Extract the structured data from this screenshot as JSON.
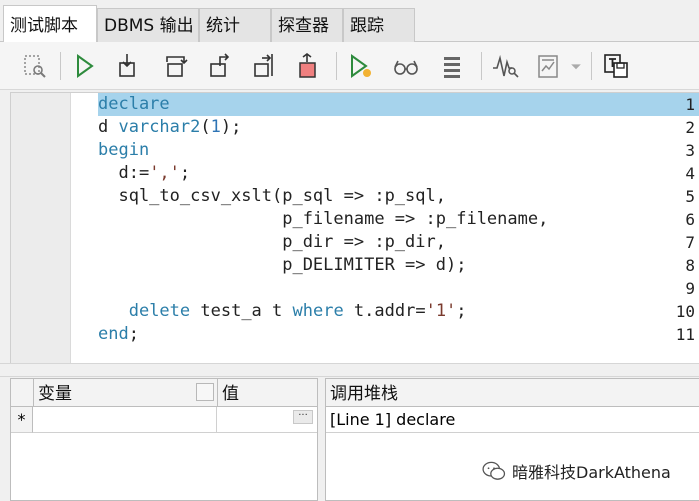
{
  "tabs": [
    {
      "label": "测试脚本",
      "active": true
    },
    {
      "label": "DBMS 输出",
      "active": false
    },
    {
      "label": "统计",
      "active": false
    },
    {
      "label": "探查器",
      "active": false
    },
    {
      "label": "跟踪",
      "active": false
    }
  ],
  "toolbar": {
    "icons": [
      "find-icon",
      "run-icon",
      "step-into-icon",
      "step-over-icon",
      "step-out-icon",
      "run-to-exception-icon",
      "stop-icon",
      "debug-run-icon",
      "watch-glasses-icon",
      "stack-list-icon",
      "profiler-wave-icon",
      "report-icon",
      "dropdown-arrow-icon",
      "save-output-icon"
    ]
  },
  "editor": {
    "line_numbers": [
      "1",
      "2",
      "3",
      "4",
      "5",
      "6",
      "7",
      "8",
      "9",
      "10",
      "11"
    ],
    "lines": [
      "declare",
      "d varchar2(1);",
      "begin",
      "  d:=',';",
      "  sql_to_csv_xslt(p_sql => :p_sql,",
      "                  p_filename => :p_filename,",
      "                  p_dir => :p_dir,",
      "                  p_DELIMITER => d);",
      "",
      "   delete test_a t where t.addr='1';",
      "end;"
    ],
    "highlighted_line": 1
  },
  "variables": {
    "col_variable": "变量",
    "col_value": "值",
    "new_row_marker": "*",
    "ellipsis": "···"
  },
  "call_stack": {
    "header": "调用堆栈",
    "rows": [
      "[Line 1] declare"
    ]
  },
  "watermark": {
    "text": "暗雅科技DarkAthena"
  }
}
